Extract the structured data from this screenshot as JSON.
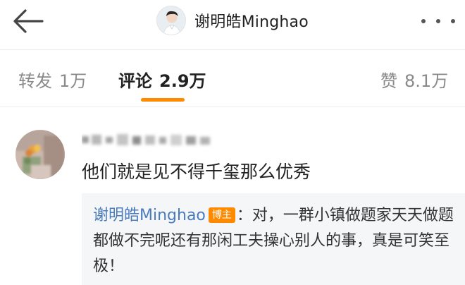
{
  "header": {
    "title": "谢明皓Minghao",
    "back_icon": "back-arrow-icon",
    "more_icon": "more-dots-icon"
  },
  "tabs": [
    {
      "label": "转发",
      "count": "1万",
      "active": false
    },
    {
      "label": "评论",
      "count": "2.9万",
      "active": true
    },
    {
      "label": "赞",
      "count": "8.1万",
      "active": false
    }
  ],
  "accent_color": "#ff8a00",
  "link_color": "#4a7bbd",
  "comment": {
    "username_blurred": true,
    "text": "他们就是见不得千玺那么优秀",
    "reply": {
      "author": "谢明皓Minghao",
      "badge": "博主",
      "separator": "：",
      "text": "对，一群小镇做题家天天做题都做不完呢还有那闲工夫操心别人的事，真是可笑至极！"
    }
  }
}
